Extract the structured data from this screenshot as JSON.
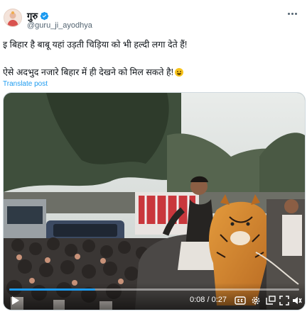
{
  "author": {
    "name": "गुरु",
    "handle": "@guru_ji_ayodhya",
    "verified_color": "#1d9bf0"
  },
  "post": {
    "line1": "इ बिहार है बाबू यहां उड़ती चिड़िया को भी  हल्दी लगा देते हैं!",
    "line2": "ऐसे अदभुद नजारे बिहार में ही देखने को मिल सकते है!",
    "line2_emoji": "face-with-tears-of-joy-icon",
    "translate_label": "Translate post"
  },
  "video": {
    "current_time": "0:08",
    "total_time": "0:27",
    "time_separator": " / ",
    "progress_fraction": 0.296,
    "accent": "#1d9bf0"
  },
  "icons": [
    "more-options-icon",
    "play-icon",
    "captions-icon",
    "settings-icon",
    "picture-in-picture-icon",
    "fullscreen-icon",
    "volume-icon",
    "verified-badge-icon"
  ]
}
